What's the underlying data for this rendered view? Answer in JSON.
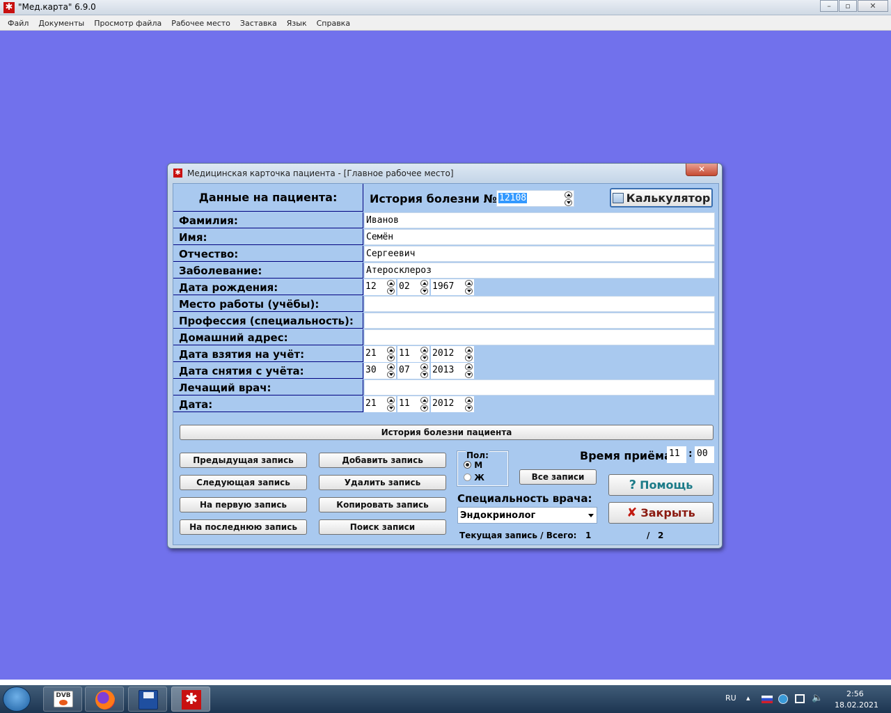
{
  "app": {
    "title": "\"Мед.карта\" 6.9.0"
  },
  "menu": [
    "Файл",
    "Документы",
    "Просмотр файла",
    "Рабочее место",
    "Заставка",
    "Язык",
    "Справка"
  ],
  "dialog": {
    "title": "Медицинская карточка пациента - [Главное рабочее место]"
  },
  "header": {
    "patient_data_label": "Данные на пациента:",
    "history_label": "История болезни №",
    "history_number": "12108",
    "calculator_label": "Калькулятор"
  },
  "fields": {
    "surname": {
      "label": "Фамилия:",
      "value": "Иванов"
    },
    "name": {
      "label": "Имя:",
      "value": "Семён"
    },
    "patronymic": {
      "label": "Отчество:",
      "value": "Сергеевич"
    },
    "disease": {
      "label": "Заболевание:",
      "value": "Атеросклероз"
    },
    "birth_date": {
      "label": "Дата рождения:",
      "day": "12",
      "month": "02",
      "year": "1967"
    },
    "workplace": {
      "label": "Место работы (учёбы):",
      "value": ""
    },
    "profession": {
      "label": "Профессия (специальность):",
      "value": ""
    },
    "address": {
      "label": "Домашний адрес:",
      "value": ""
    },
    "reg_date": {
      "label": "Дата взятия на учёт:",
      "day": "21",
      "month": "11",
      "year": "2012"
    },
    "unreg_date": {
      "label": "Дата снятия с учёта:",
      "day": "30",
      "month": "07",
      "year": "2013"
    },
    "doctor": {
      "label": "Лечащий врач:",
      "value": ""
    },
    "date": {
      "label": "Дата:",
      "day": "21",
      "month": "11",
      "year": "2012"
    }
  },
  "history_button": "История болезни пациента",
  "nav": {
    "prev": "Предыдущая запись",
    "next": "Следующая запись",
    "first": "На первую запись",
    "last": "На последнюю запись",
    "add": "Добавить запись",
    "delete": "Удалить запись",
    "copy": "Копировать запись",
    "search": "Поиск записи"
  },
  "gender": {
    "label": "Пол:",
    "male": "М",
    "female": "Ж",
    "selected": "М"
  },
  "all_records": "Все записи",
  "appointment": {
    "label": "Время приёма:",
    "hour": "11",
    "minute": "00",
    "sep": ":"
  },
  "specialty": {
    "label": "Специальность врача:",
    "value": "Эндокринолог"
  },
  "record_status": {
    "label": "Текущая запись / Всего:",
    "current": "1",
    "sep": "/",
    "total": "2"
  },
  "help_label": "Помощь",
  "close_label": "Закрыть",
  "taskbar": {
    "lang": "RU",
    "time": "2:56",
    "date": "18.02.2021",
    "dvb_label": "DVB"
  }
}
